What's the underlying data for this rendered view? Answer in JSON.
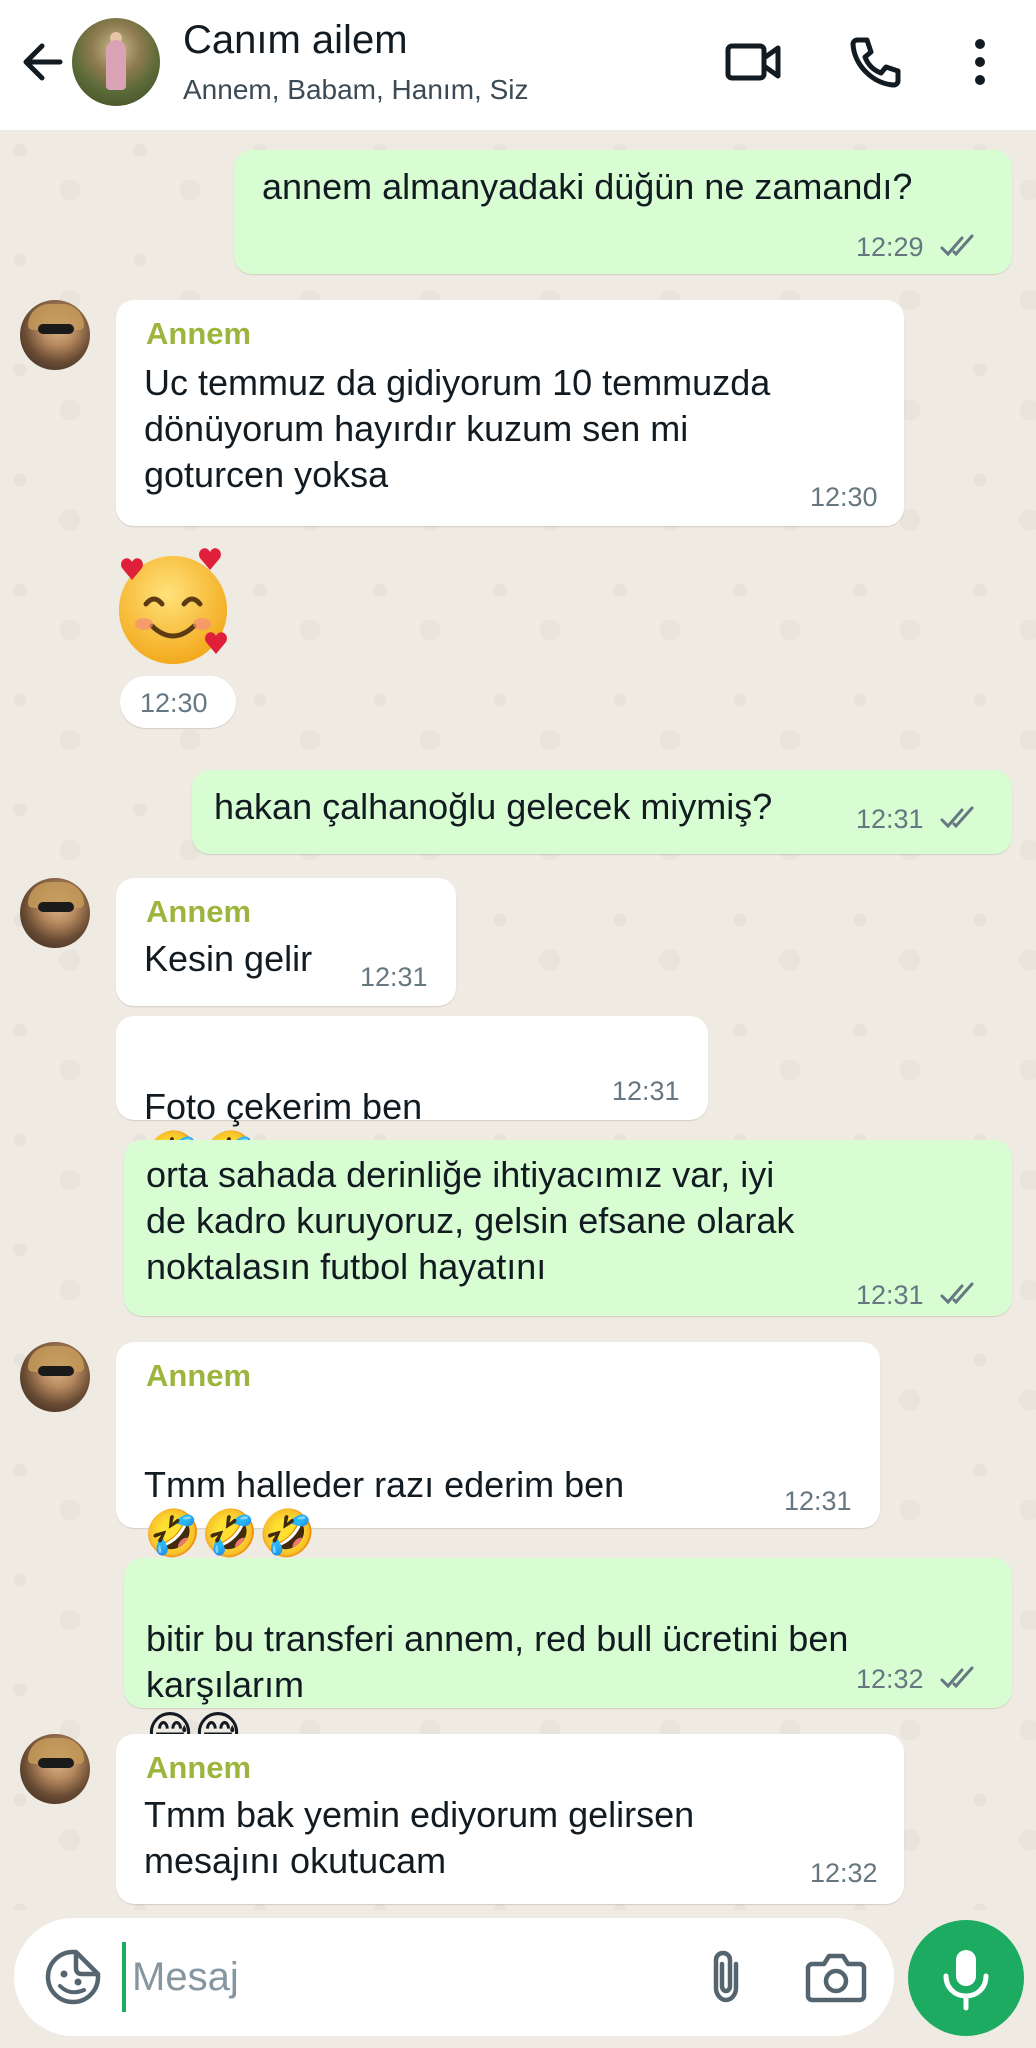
{
  "header": {
    "title": "Canım ailem",
    "members": "Annem, Babam, Hanım, Siz"
  },
  "messages": [
    {
      "dir": "out",
      "text": "annem almanyadaki düğün ne zamandı?",
      "time": "12:29",
      "status": "read"
    },
    {
      "dir": "in",
      "sender": "Annem",
      "text": "Uc temmuz da gidiyorum 10 temmuzda\ndönüyorum hayırdır kuzum sen mi\ngoturcen yoksa",
      "time": "12:30"
    },
    {
      "dir": "in",
      "type": "emoji",
      "emoji": "🥰",
      "time": "12:30"
    },
    {
      "dir": "out",
      "text": "hakan çalhanoğlu gelecek miymiş?",
      "time": "12:31",
      "status": "read"
    },
    {
      "dir": "in",
      "sender": "Annem",
      "text": "Kesin gelir",
      "time": "12:31"
    },
    {
      "dir": "in",
      "text": "Foto çekerim ben",
      "emojis": "🤣🤣",
      "time": "12:31"
    },
    {
      "dir": "out",
      "text": "orta sahada derinliğe ihtiyacımız var, iyi\nde kadro kuruyoruz, gelsin efsane olarak\nnoktalasın futbol hayatını",
      "time": "12:31",
      "status": "read"
    },
    {
      "dir": "in",
      "sender": "Annem",
      "text": "Tmm halleder razı ederim ben",
      "emojis": "🤣🤣🤣",
      "time": "12:31"
    },
    {
      "dir": "out",
      "text": "bitir bu transferi annem, red bull ücretini ben\nkarşılarım",
      "emojis": "😅😅",
      "time": "12:32",
      "status": "read"
    },
    {
      "dir": "in",
      "sender": "Annem",
      "text": "Tmm bak yemin ediyorum gelirsen\nmesajını okutucam",
      "time": "12:32"
    }
  ],
  "composer": {
    "placeholder": "Mesaj"
  },
  "colors": {
    "outgoing_bubble": "#d9fdd3",
    "incoming_bubble": "#ffffff",
    "sender_name": "#9db53c",
    "accent_green": "#1daa61",
    "read_ticks": "#667781",
    "chat_background": "#efeae2"
  },
  "icons": {
    "back": "back-arrow-icon",
    "video": "video-call-icon",
    "call": "phone-icon",
    "more": "more-vert-icon",
    "sticker": "sticker-icon",
    "attach": "paperclip-icon",
    "camera": "camera-icon",
    "mic": "microphone-icon"
  }
}
